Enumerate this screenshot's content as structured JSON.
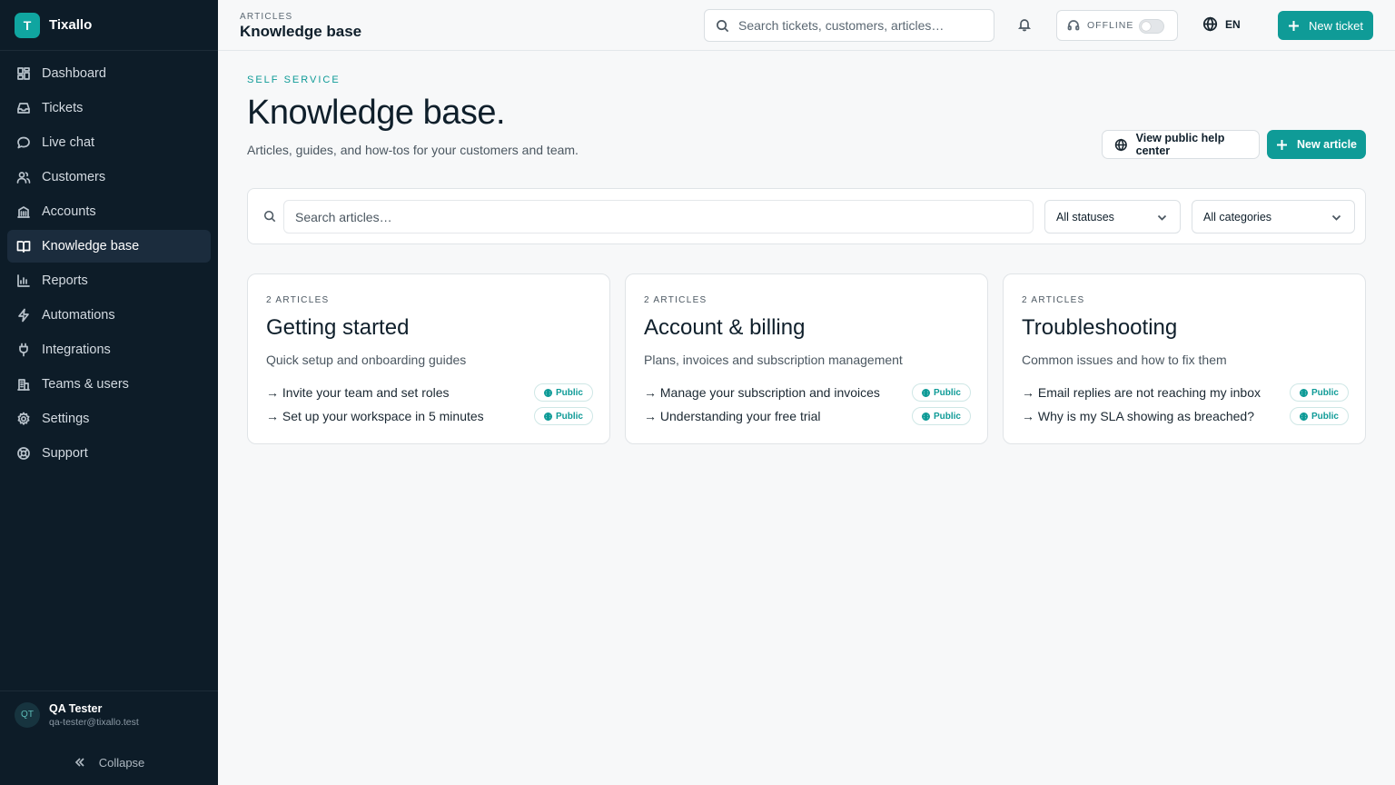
{
  "brand": {
    "initial": "T",
    "name": "Tixallo"
  },
  "sidebar": {
    "items": [
      {
        "label": "Dashboard",
        "icon": "dashboard-icon"
      },
      {
        "label": "Tickets",
        "icon": "inbox-icon"
      },
      {
        "label": "Live chat",
        "icon": "chat-icon"
      },
      {
        "label": "Customers",
        "icon": "users-icon"
      },
      {
        "label": "Accounts",
        "icon": "building-icon"
      },
      {
        "label": "Knowledge base",
        "icon": "book-icon",
        "active": true
      },
      {
        "label": "Reports",
        "icon": "bar-chart-icon"
      },
      {
        "label": "Automations",
        "icon": "bolt-icon"
      },
      {
        "label": "Integrations",
        "icon": "plug-icon"
      },
      {
        "label": "Teams & users",
        "icon": "team-icon"
      },
      {
        "label": "Settings",
        "icon": "gear-icon"
      },
      {
        "label": "Support",
        "icon": "lifebuoy-icon"
      }
    ],
    "user": {
      "initials": "QT",
      "name": "QA Tester",
      "email": "qa-tester@tixallo.test"
    },
    "collapse_label": "Collapse"
  },
  "header": {
    "breadcrumb": "ARTICLES",
    "title": "Knowledge base",
    "search_placeholder": "Search tickets, customers, articles…",
    "status_label": "OFFLINE",
    "language": "EN",
    "new_ticket_label": "New ticket"
  },
  "main": {
    "eyebrow": "SELF SERVICE",
    "title": "Knowledge base.",
    "subtitle": "Articles, guides, and how-tos for your customers and team.",
    "view_help_center_label": "View public help center",
    "new_article_label": "New article",
    "filters": {
      "search_placeholder": "Search articles…",
      "status_value": "All statuses",
      "category_value": "All categories"
    },
    "categories": [
      {
        "count": "2 ARTICLES",
        "title": "Getting started",
        "description": "Quick setup and onboarding guides",
        "articles": [
          {
            "title": "→ Invite your team and set roles",
            "badge": "Public"
          },
          {
            "title": "→ Set up your workspace in 5 minutes",
            "badge": "Public"
          }
        ]
      },
      {
        "count": "2 ARTICLES",
        "title": "Account & billing",
        "description": "Plans, invoices and subscription management",
        "articles": [
          {
            "title": "→ Manage your subscription and invoices",
            "badge": "Public"
          },
          {
            "title": "→ Understanding your free trial",
            "badge": "Public"
          }
        ]
      },
      {
        "count": "2 ARTICLES",
        "title": "Troubleshooting",
        "description": "Common issues and how to fix them",
        "articles": [
          {
            "title": "→ Email replies are not reaching my inbox",
            "badge": "Public"
          },
          {
            "title": "→ Why is my SLA showing as breached?",
            "badge": "Public"
          }
        ]
      }
    ]
  },
  "colors": {
    "accent": "#0f9b97",
    "sidebar_bg": "#0d1c28",
    "sidebar_active": "#1b2c3d"
  }
}
